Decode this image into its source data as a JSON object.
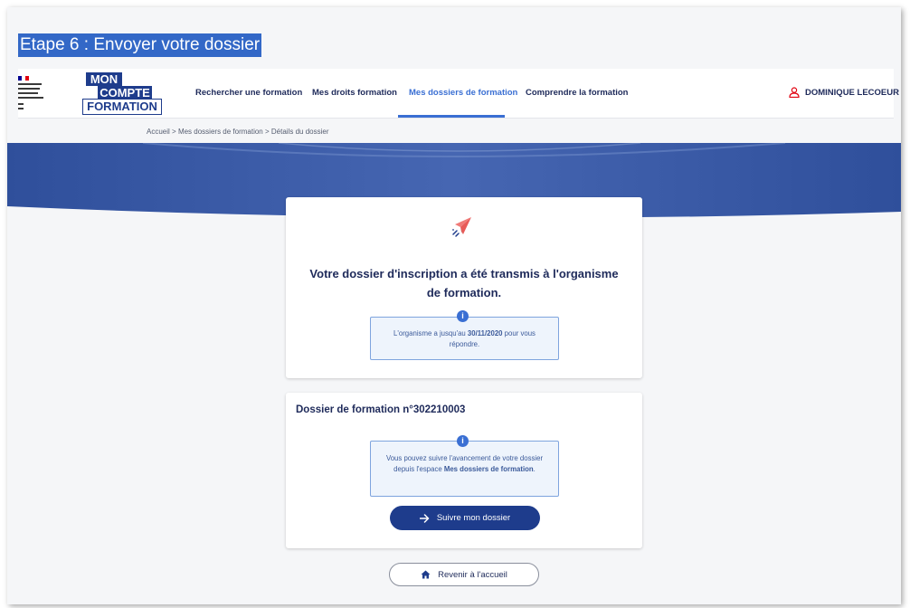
{
  "step_title": "Etape 6 : Envoyer votre dossier",
  "ministry_text": [
    "MINISTÈRE",
    "DU TRAVAIL,",
    "DE L'EMPLOI",
    "ET DE L'INSERTION"
  ],
  "logo": {
    "line1": "MON",
    "line2": "COMPTE",
    "line3": "FORMATION"
  },
  "nav": {
    "items": [
      {
        "label": "Rechercher une formation",
        "active": false
      },
      {
        "label": "Mes droits formation",
        "active": false
      },
      {
        "label": "Mes dossiers de formation",
        "active": true
      },
      {
        "label": "Comprendre la formation",
        "active": false
      }
    ]
  },
  "user": {
    "name": "DOMINIQUE LECOEUR",
    "icon": "user-icon"
  },
  "breadcrumb": {
    "items": [
      "Accueil",
      "Mes dossiers de formation",
      "Détails du dossier"
    ],
    "separator": ">"
  },
  "confirmation": {
    "icon": "paper-plane-icon",
    "headline": "Votre dossier d'inscription a été transmis à l'organisme de formation.",
    "info": {
      "before": "L'organisme a jusqu'au ",
      "date": "30/11/2020",
      "after": " pour vous répondre."
    }
  },
  "dossier": {
    "title": "Dossier de formation n°302210003",
    "info": {
      "before": "Vous pouvez suivre l'avancement de votre dossier depuis l'espace ",
      "strong": "Mes dossiers de formation",
      "after": "."
    },
    "follow_button": "Suivre mon dossier"
  },
  "home_button": "Revenir à l'accueil",
  "colors": {
    "primary": "#1e3c8c",
    "accent": "#3a6fd3",
    "highlight": "#3368c7",
    "banner": "#3d5ea8"
  }
}
